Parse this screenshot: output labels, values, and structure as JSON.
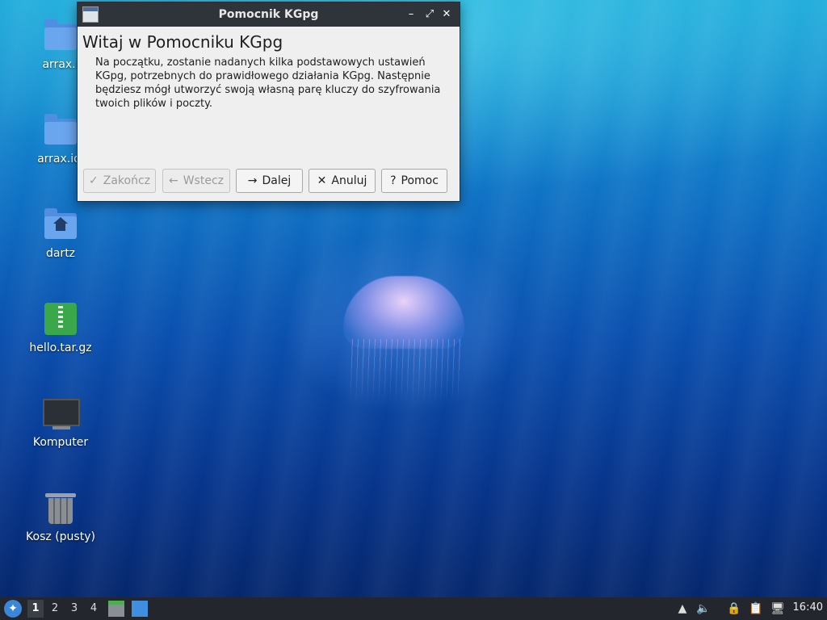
{
  "desktop": {
    "icons": [
      {
        "label": "arrax.i",
        "icon": "folder-icon"
      },
      {
        "label": "arrax.io.",
        "icon": "folder-icon"
      },
      {
        "label": "dartz",
        "icon": "home-folder-icon"
      },
      {
        "label": "hello.tar.gz",
        "icon": "archive-icon"
      },
      {
        "label": "Komputer",
        "icon": "computer-icon"
      },
      {
        "label": "Kosz (pusty)",
        "icon": "trash-icon"
      }
    ]
  },
  "dialog": {
    "title": "Pomocnik KGpg",
    "heading": "Witaj w Pomocniku KGpg",
    "body": "Na początku, zostanie nadanych kilka podstawowych ustawień KGpg, potrzebnych do prawidłowego działania KGpg. Następnie będziesz mógł utworzyć swoją własną parę kluczy do szyfrowania twoich plików i poczty.",
    "window_controls": {
      "minimize": "–",
      "maximize": "⤢",
      "close": "✕"
    },
    "buttons": {
      "finish": {
        "label": "Zakończ",
        "icon": "✓"
      },
      "back": {
        "label": "Wstecz",
        "icon": "←"
      },
      "next": {
        "label": "Dalej",
        "icon": "→"
      },
      "cancel": {
        "label": "Anuluj",
        "icon": "✕"
      },
      "help": {
        "label": "Pomoc",
        "icon": "?"
      }
    }
  },
  "taskbar": {
    "workspaces": [
      "1",
      "2",
      "3",
      "4"
    ],
    "active_workspace": "1",
    "clock": "16:40"
  },
  "colors": {
    "accent": "#3a86d8",
    "lock": "#f2c12e"
  }
}
